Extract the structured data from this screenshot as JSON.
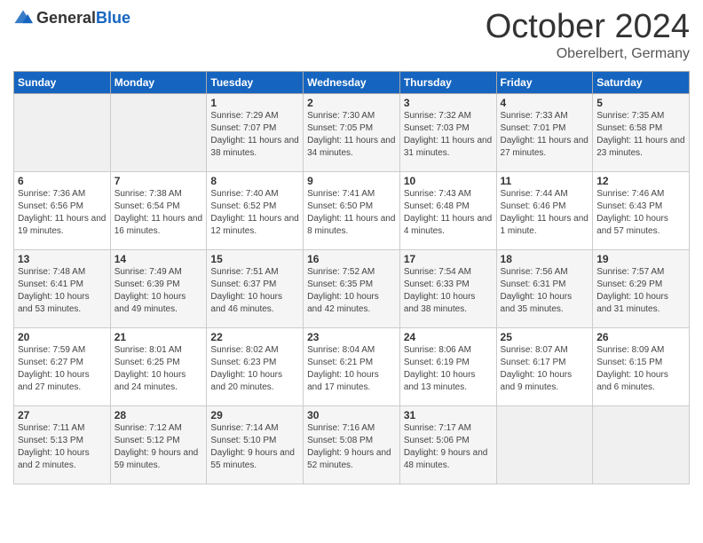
{
  "header": {
    "logo": {
      "general": "General",
      "blue": "Blue"
    },
    "title": "October 2024",
    "location": "Oberelbert, Germany"
  },
  "weekdays": [
    "Sunday",
    "Monday",
    "Tuesday",
    "Wednesday",
    "Thursday",
    "Friday",
    "Saturday"
  ],
  "weeks": [
    [
      {
        "day": null
      },
      {
        "day": null
      },
      {
        "day": "1",
        "sunrise": "Sunrise: 7:29 AM",
        "sunset": "Sunset: 7:07 PM",
        "daylight": "Daylight: 11 hours and 38 minutes."
      },
      {
        "day": "2",
        "sunrise": "Sunrise: 7:30 AM",
        "sunset": "Sunset: 7:05 PM",
        "daylight": "Daylight: 11 hours and 34 minutes."
      },
      {
        "day": "3",
        "sunrise": "Sunrise: 7:32 AM",
        "sunset": "Sunset: 7:03 PM",
        "daylight": "Daylight: 11 hours and 31 minutes."
      },
      {
        "day": "4",
        "sunrise": "Sunrise: 7:33 AM",
        "sunset": "Sunset: 7:01 PM",
        "daylight": "Daylight: 11 hours and 27 minutes."
      },
      {
        "day": "5",
        "sunrise": "Sunrise: 7:35 AM",
        "sunset": "Sunset: 6:58 PM",
        "daylight": "Daylight: 11 hours and 23 minutes."
      }
    ],
    [
      {
        "day": "6",
        "sunrise": "Sunrise: 7:36 AM",
        "sunset": "Sunset: 6:56 PM",
        "daylight": "Daylight: 11 hours and 19 minutes."
      },
      {
        "day": "7",
        "sunrise": "Sunrise: 7:38 AM",
        "sunset": "Sunset: 6:54 PM",
        "daylight": "Daylight: 11 hours and 16 minutes."
      },
      {
        "day": "8",
        "sunrise": "Sunrise: 7:40 AM",
        "sunset": "Sunset: 6:52 PM",
        "daylight": "Daylight: 11 hours and 12 minutes."
      },
      {
        "day": "9",
        "sunrise": "Sunrise: 7:41 AM",
        "sunset": "Sunset: 6:50 PM",
        "daylight": "Daylight: 11 hours and 8 minutes."
      },
      {
        "day": "10",
        "sunrise": "Sunrise: 7:43 AM",
        "sunset": "Sunset: 6:48 PM",
        "daylight": "Daylight: 11 hours and 4 minutes."
      },
      {
        "day": "11",
        "sunrise": "Sunrise: 7:44 AM",
        "sunset": "Sunset: 6:46 PM",
        "daylight": "Daylight: 11 hours and 1 minute."
      },
      {
        "day": "12",
        "sunrise": "Sunrise: 7:46 AM",
        "sunset": "Sunset: 6:43 PM",
        "daylight": "Daylight: 10 hours and 57 minutes."
      }
    ],
    [
      {
        "day": "13",
        "sunrise": "Sunrise: 7:48 AM",
        "sunset": "Sunset: 6:41 PM",
        "daylight": "Daylight: 10 hours and 53 minutes."
      },
      {
        "day": "14",
        "sunrise": "Sunrise: 7:49 AM",
        "sunset": "Sunset: 6:39 PM",
        "daylight": "Daylight: 10 hours and 49 minutes."
      },
      {
        "day": "15",
        "sunrise": "Sunrise: 7:51 AM",
        "sunset": "Sunset: 6:37 PM",
        "daylight": "Daylight: 10 hours and 46 minutes."
      },
      {
        "day": "16",
        "sunrise": "Sunrise: 7:52 AM",
        "sunset": "Sunset: 6:35 PM",
        "daylight": "Daylight: 10 hours and 42 minutes."
      },
      {
        "day": "17",
        "sunrise": "Sunrise: 7:54 AM",
        "sunset": "Sunset: 6:33 PM",
        "daylight": "Daylight: 10 hours and 38 minutes."
      },
      {
        "day": "18",
        "sunrise": "Sunrise: 7:56 AM",
        "sunset": "Sunset: 6:31 PM",
        "daylight": "Daylight: 10 hours and 35 minutes."
      },
      {
        "day": "19",
        "sunrise": "Sunrise: 7:57 AM",
        "sunset": "Sunset: 6:29 PM",
        "daylight": "Daylight: 10 hours and 31 minutes."
      }
    ],
    [
      {
        "day": "20",
        "sunrise": "Sunrise: 7:59 AM",
        "sunset": "Sunset: 6:27 PM",
        "daylight": "Daylight: 10 hours and 27 minutes."
      },
      {
        "day": "21",
        "sunrise": "Sunrise: 8:01 AM",
        "sunset": "Sunset: 6:25 PM",
        "daylight": "Daylight: 10 hours and 24 minutes."
      },
      {
        "day": "22",
        "sunrise": "Sunrise: 8:02 AM",
        "sunset": "Sunset: 6:23 PM",
        "daylight": "Daylight: 10 hours and 20 minutes."
      },
      {
        "day": "23",
        "sunrise": "Sunrise: 8:04 AM",
        "sunset": "Sunset: 6:21 PM",
        "daylight": "Daylight: 10 hours and 17 minutes."
      },
      {
        "day": "24",
        "sunrise": "Sunrise: 8:06 AM",
        "sunset": "Sunset: 6:19 PM",
        "daylight": "Daylight: 10 hours and 13 minutes."
      },
      {
        "day": "25",
        "sunrise": "Sunrise: 8:07 AM",
        "sunset": "Sunset: 6:17 PM",
        "daylight": "Daylight: 10 hours and 9 minutes."
      },
      {
        "day": "26",
        "sunrise": "Sunrise: 8:09 AM",
        "sunset": "Sunset: 6:15 PM",
        "daylight": "Daylight: 10 hours and 6 minutes."
      }
    ],
    [
      {
        "day": "27",
        "sunrise": "Sunrise: 7:11 AM",
        "sunset": "Sunset: 5:13 PM",
        "daylight": "Daylight: 10 hours and 2 minutes."
      },
      {
        "day": "28",
        "sunrise": "Sunrise: 7:12 AM",
        "sunset": "Sunset: 5:12 PM",
        "daylight": "Daylight: 9 hours and 59 minutes."
      },
      {
        "day": "29",
        "sunrise": "Sunrise: 7:14 AM",
        "sunset": "Sunset: 5:10 PM",
        "daylight": "Daylight: 9 hours and 55 minutes."
      },
      {
        "day": "30",
        "sunrise": "Sunrise: 7:16 AM",
        "sunset": "Sunset: 5:08 PM",
        "daylight": "Daylight: 9 hours and 52 minutes."
      },
      {
        "day": "31",
        "sunrise": "Sunrise: 7:17 AM",
        "sunset": "Sunset: 5:06 PM",
        "daylight": "Daylight: 9 hours and 48 minutes."
      },
      {
        "day": null
      },
      {
        "day": null
      }
    ]
  ]
}
